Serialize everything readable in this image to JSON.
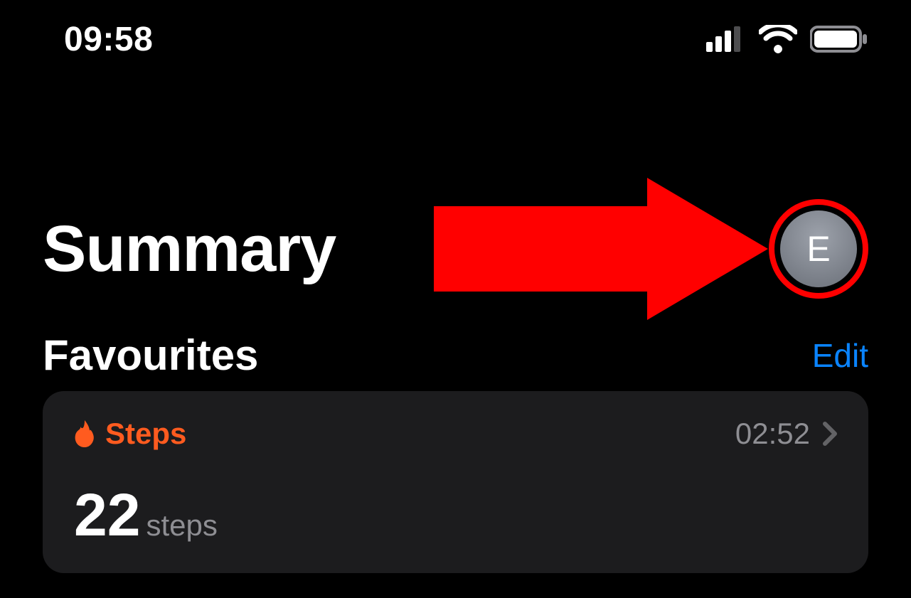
{
  "status": {
    "time": "09:58"
  },
  "header": {
    "title": "Summary",
    "avatar_initial": "E"
  },
  "favourites": {
    "title": "Favourites",
    "edit_label": "Edit"
  },
  "card": {
    "icon": "flame-icon",
    "label": "Steps",
    "timestamp": "02:52",
    "value": "22",
    "unit": "steps",
    "accent_color": "#ff5b1f"
  },
  "annotation": {
    "type": "arrow",
    "color": "#ff0000",
    "target": "profile-avatar"
  }
}
